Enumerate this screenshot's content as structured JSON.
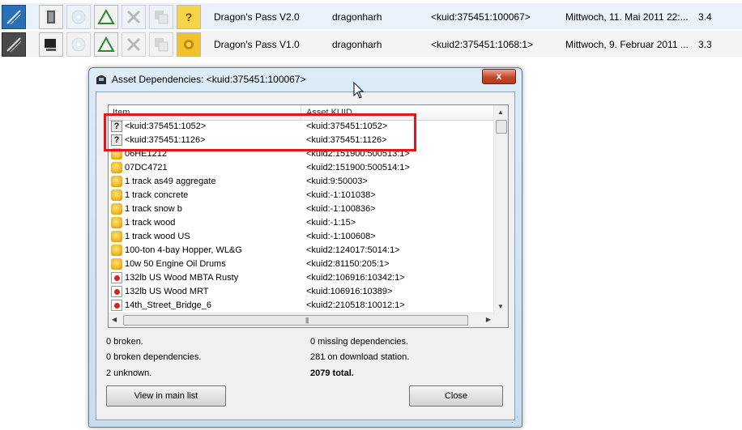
{
  "background_rows": [
    {
      "name": "Dragon's Pass V2.0",
      "author": "dragonharh",
      "kuid": "<kuid:375451:100067>",
      "date": "Mittwoch, 11. Mai 2011 22:...",
      "version": "3.4"
    },
    {
      "name": "Dragon's Pass V1.0",
      "author": "dragonharh",
      "kuid": "<kuid2:375451:1068:1>",
      "date": "Mittwoch, 9. Februar 2011 ...",
      "version": "3.3"
    }
  ],
  "dialog": {
    "title": "Asset Dependencies: <kuid:375451:100067>",
    "close_symbol": "x",
    "columns": {
      "item": "Item",
      "kuid": "Asset KUID"
    },
    "rows": [
      {
        "item": "<kuid:375451:1052>",
        "kuid": "<kuid:375451:1052>",
        "icon": "unknown-icon"
      },
      {
        "item": "<kuid:375451:1126>",
        "kuid": "<kuid:375451:1126>",
        "icon": "unknown-icon"
      },
      {
        "item": "06HE1212",
        "kuid": "<kuid2:151900:500513:1>",
        "icon": "asset-icon"
      },
      {
        "item": "07DC4721",
        "kuid": "<kuid2:151900:500514:1>",
        "icon": "asset-icon"
      },
      {
        "item": "1 track as49 aggregate",
        "kuid": "<kuid:9:50003>",
        "icon": "asset-icon"
      },
      {
        "item": "1 track concrete",
        "kuid": "<kuid:-1:101038>",
        "icon": "asset-icon"
      },
      {
        "item": "1 track snow b",
        "kuid": "<kuid:-1:100836>",
        "icon": "asset-icon"
      },
      {
        "item": "1 track wood",
        "kuid": "<kuid:-1:15>",
        "icon": "asset-icon"
      },
      {
        "item": "1 track wood US",
        "kuid": "<kuid:-1:100608>",
        "icon": "asset-icon"
      },
      {
        "item": "100-ton 4-bay Hopper, WL&G",
        "kuid": "<kuid2:124017:5014:1>",
        "icon": "asset-icon"
      },
      {
        "item": "10w 50 Engine Oil Drums",
        "kuid": "<kuid2:81150:205:1>",
        "icon": "asset-icon"
      },
      {
        "item": "132lb US Wood MBTA Rusty",
        "kuid": "<kuid2:106916:10342:1>",
        "icon": "texture-icon"
      },
      {
        "item": "132lb US Wood MRT",
        "kuid": "<kuid:106916:10389>",
        "icon": "texture-icon"
      },
      {
        "item": "14th_Street_Bridge_6",
        "kuid": "<kuid2:210518:10012:1>",
        "icon": "texture-icon"
      }
    ],
    "status": {
      "broken": "0 broken.",
      "broken_dependencies": "0 broken dependencies.",
      "unknown": "2 unknown.",
      "missing_dependencies": "0 missing dependencies.",
      "download_station": "281 on download station.",
      "total": "2079 total."
    },
    "buttons": {
      "view_main_list": "View in main list",
      "close": "Close"
    }
  },
  "colors": {
    "highlight": "#e2161c",
    "selection_row": "#eaf1fb"
  }
}
